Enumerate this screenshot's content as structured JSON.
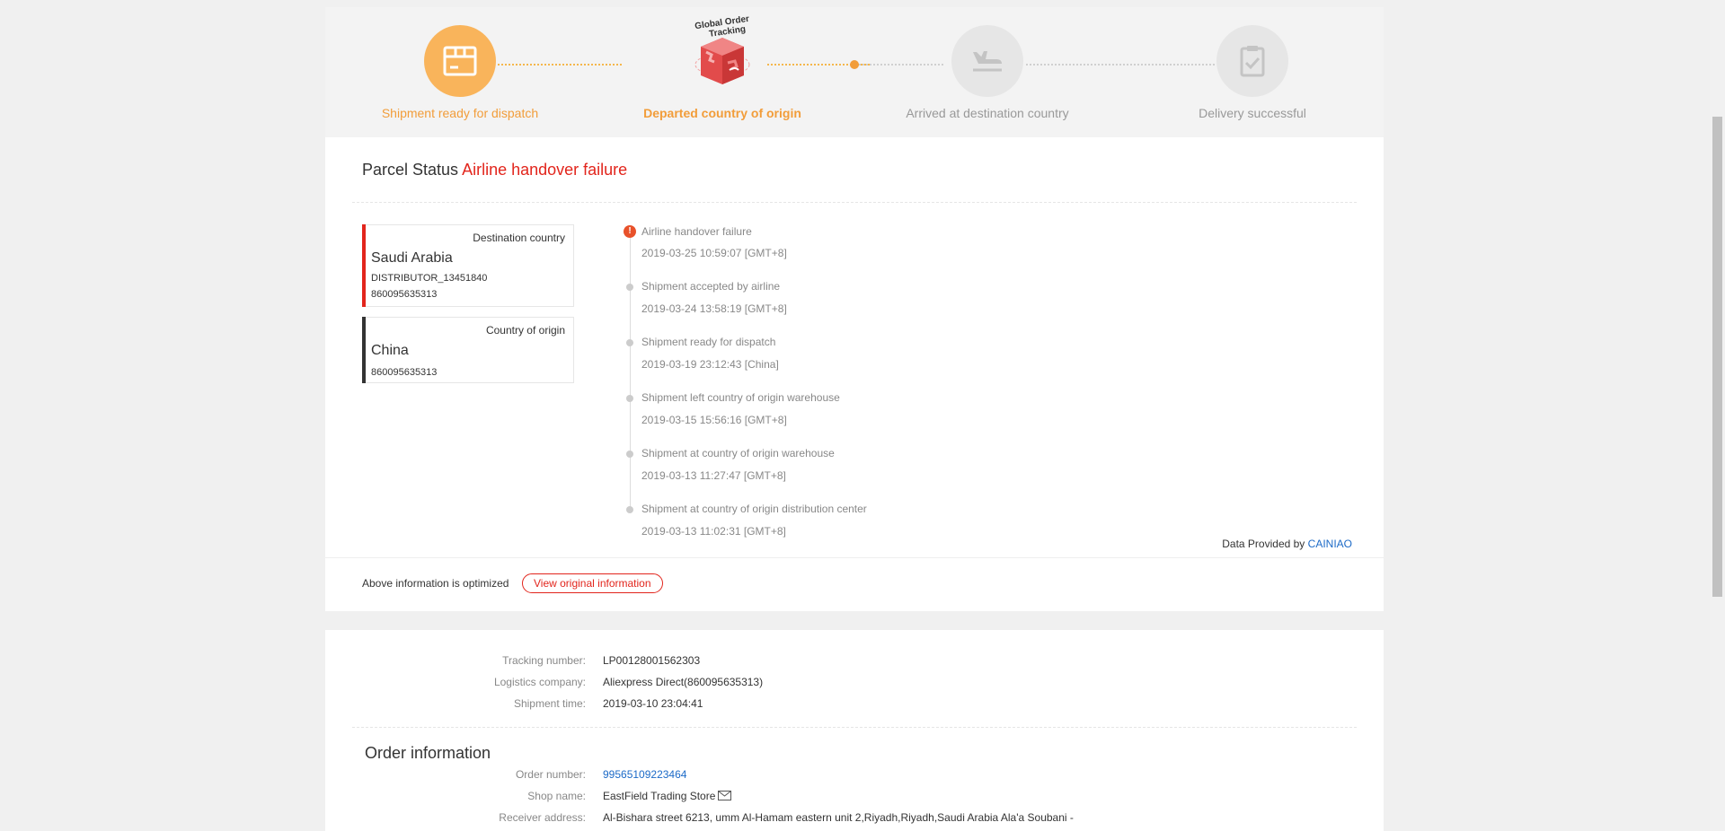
{
  "progress": {
    "steps": [
      {
        "label": "Shipment ready for dispatch",
        "icon": "box-icon",
        "state": "done"
      },
      {
        "label": "Departed country of origin",
        "icon": "global-order-tracking-cube-icon",
        "state": "current",
        "badge_text": "Global Order Tracking"
      },
      {
        "label": "Arrived at destination country",
        "icon": "airplane-landing-icon",
        "state": "pending"
      },
      {
        "label": "Delivery successful",
        "icon": "clipboard-check-icon",
        "state": "pending"
      }
    ]
  },
  "parcel": {
    "status_label": "Parcel Status",
    "status_value": "Airline handover failure"
  },
  "destination": {
    "title": "Destination country",
    "country": "Saudi Arabia",
    "distributor": "DISTRIBUTOR_13451840",
    "number": "860095635313"
  },
  "origin": {
    "title": "Country of origin",
    "country": "China",
    "number": "860095635313"
  },
  "timeline": [
    {
      "event": "Airline handover failure",
      "time": "2019-03-25 10:59:07 [GMT+8]",
      "alert": true
    },
    {
      "event": "Shipment accepted by airline",
      "time": "2019-03-24 13:58:19 [GMT+8]",
      "alert": false
    },
    {
      "event": "Shipment ready for dispatch",
      "time": "2019-03-19 23:12:43 [China]",
      "alert": false
    },
    {
      "event": "Shipment left country of origin warehouse",
      "time": "2019-03-15 15:56:16 [GMT+8]",
      "alert": false
    },
    {
      "event": "Shipment at country of origin warehouse",
      "time": "2019-03-13 11:27:47 [GMT+8]",
      "alert": false
    },
    {
      "event": "Shipment at country of origin distribution center",
      "time": "2019-03-13 11:02:31 [GMT+8]",
      "alert": false
    }
  ],
  "provider": {
    "prefix": "Data Provided by",
    "name": "CAINIAO"
  },
  "optimized": {
    "text": "Above information is optimized",
    "button": "View original information"
  },
  "shipment": {
    "tracking_label": "Tracking number:",
    "tracking_value": "LP00128001562303",
    "company_label": "Logistics company:",
    "company_value": "Aliexpress Direct(860095635313)",
    "time_label": "Shipment time:",
    "time_value": "2019-03-10 23:04:41"
  },
  "order": {
    "heading": "Order information",
    "number_label": "Order number:",
    "number_value": "99565109223464",
    "shop_label": "Shop name:",
    "shop_value": "EastField Trading Store",
    "address_label": "Receiver address:",
    "address_value": "Al-Bishara street 6213, umm Al-Hamam eastern unit 2,Riyadh,Riyadh,Saudi Arabia Ala'a Soubani -"
  },
  "colors": {
    "accent_orange": "#f29d3a",
    "alert_red": "#e2251c",
    "link_blue": "#1c6ac7"
  }
}
